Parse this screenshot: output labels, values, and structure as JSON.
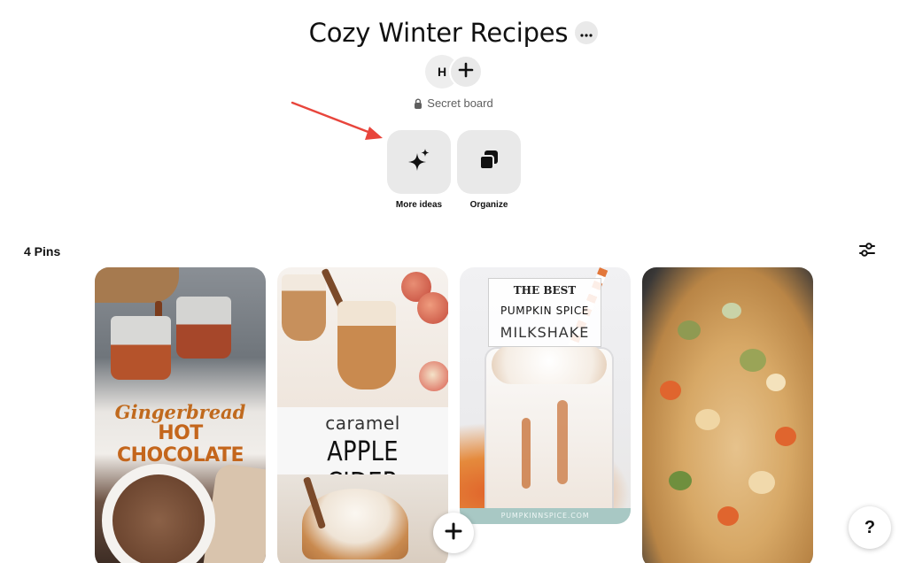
{
  "board": {
    "title": "Cozy Winter Recipes",
    "more_icon": "ellipsis-icon",
    "owner_initial": "H",
    "visibility": "Secret board"
  },
  "actions": [
    {
      "label": "More ideas",
      "icon": "sparkle-icon"
    },
    {
      "label": "Organize",
      "icon": "organize-icon"
    }
  ],
  "pins_count": "4 Pins",
  "pins": [
    {
      "title_small": "Gingerbread",
      "title_big": "HOT CHOCOLATE"
    },
    {
      "title_small": "caramel",
      "title_big": "APPLE CIDER"
    },
    {
      "line1": "THE BEST",
      "line2": "PUMPKIN SPICE",
      "line3": "MILKSHAKE",
      "footer": "PUMPKINNSPICE.COM"
    },
    {}
  ],
  "help_label": "?",
  "colors": {
    "accent_arrow": "#e8453c",
    "tile_bg": "#e9e9e9",
    "gingerbread_orange": "#c4661c"
  }
}
